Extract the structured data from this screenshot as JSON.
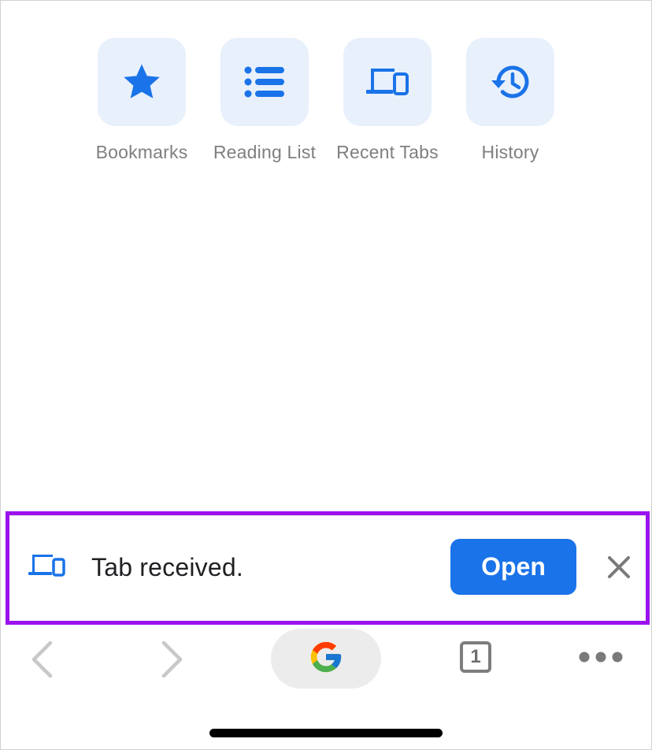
{
  "shortcuts": [
    {
      "label": "Bookmarks",
      "icon": "star-icon"
    },
    {
      "label": "Reading List",
      "icon": "list-icon"
    },
    {
      "label": "Recent Tabs",
      "icon": "devices-icon"
    },
    {
      "label": "History",
      "icon": "history-icon"
    }
  ],
  "infobar": {
    "message": "Tab received.",
    "open_label": "Open",
    "icon": "devices-icon",
    "close_icon": "close-icon"
  },
  "toolbar": {
    "tab_count": "1",
    "omnibox_icon": "google-g-icon"
  },
  "colors": {
    "accent": "#1a73e8",
    "tile_background": "#e8f0fc",
    "highlight_border": "#9a12ee",
    "label_gray": "#7f7f7f"
  }
}
